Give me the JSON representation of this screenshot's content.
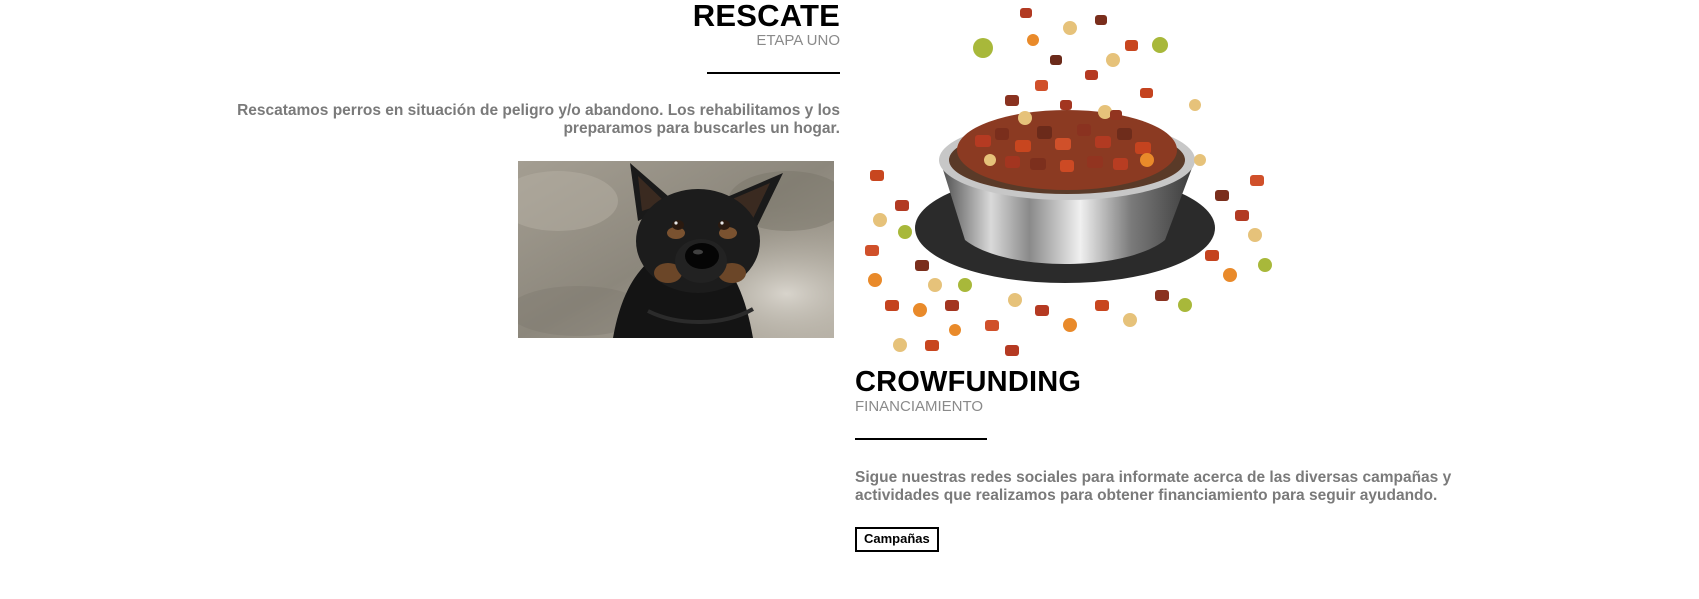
{
  "rescate": {
    "title": "RESCATE",
    "subtitle": "ETAPA UNO",
    "description": "Rescatamos perros en situación de peligro y/o abandono. Los rehabilitamos y los preparamos para buscarles un hogar.",
    "image": "dog-photo"
  },
  "food_image": "dog-food-bowl-photo",
  "crowdfunding": {
    "title": "CROWFUNDING",
    "subtitle": "FINANCIAMIENTO",
    "description": "Sigue nuestras redes sociales para informate acerca de las diversas campañas y actividades que realizamos para obtener financiamiento para seguir ayudando.",
    "button_label": "Campañas"
  },
  "colors": {
    "title": "#000000",
    "subtitle": "#8a8a8a",
    "body_text": "#7a7a7a",
    "background": "#ffffff"
  }
}
